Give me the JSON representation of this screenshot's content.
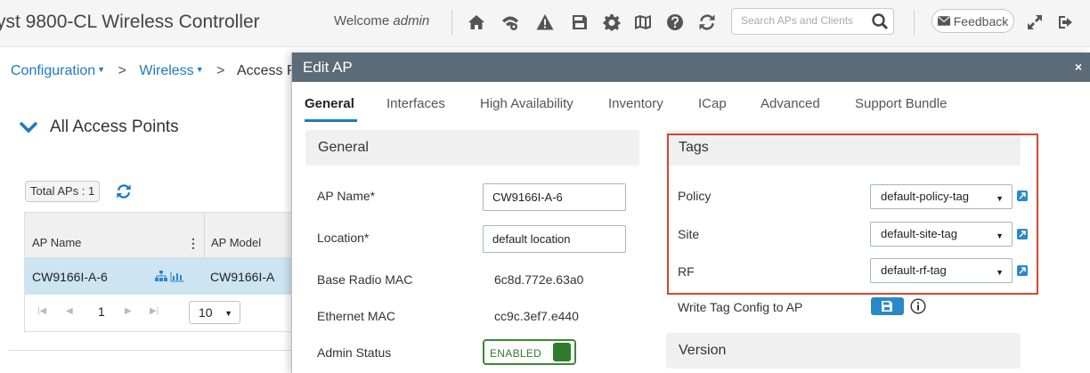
{
  "header": {
    "app_title": "yst 9800-CL Wireless Controller",
    "welcome_prefix": "Welcome",
    "username": "admin",
    "search_placeholder": "Search APs and Clients",
    "feedback_label": "Feedback",
    "icons": [
      "home-icon",
      "wireless-setup-icon",
      "alert-icon",
      "save-icon",
      "gear-icon",
      "map-icon",
      "help-icon",
      "refresh-icon",
      "search-icon",
      "expand-icon",
      "logout-icon"
    ]
  },
  "breadcrumb": {
    "item1": "Configuration",
    "item2": "Wireless",
    "item3": "Access Po",
    "separator": ">"
  },
  "left_panel": {
    "section_title": "All Access Points",
    "total_aps_label": "Total APs : 1",
    "table": {
      "columns": [
        "AP Name",
        "AP Model"
      ],
      "rows": [
        {
          "ap_name": "CW9166I-A-6",
          "ap_model": "CW9166I-A"
        }
      ]
    },
    "pagination": {
      "page": "1",
      "page_size": "10"
    }
  },
  "modal": {
    "title": "Edit AP",
    "close_label": "×",
    "tabs": [
      "General",
      "Interfaces",
      "High Availability",
      "Inventory",
      "ICap",
      "Advanced",
      "Support Bundle"
    ],
    "active_tab": "General",
    "general": {
      "header": "General",
      "ap_name_label": "AP Name*",
      "ap_name_value": "CW9166I-A-6",
      "location_label": "Location*",
      "location_value": "default location",
      "base_radio_mac_label": "Base Radio MAC",
      "base_radio_mac_value": "6c8d.772e.63a0",
      "ethernet_mac_label": "Ethernet MAC",
      "ethernet_mac_value": "cc9c.3ef7.e440",
      "admin_status_label": "Admin Status",
      "admin_status_value": "ENABLED"
    },
    "tags": {
      "header": "Tags",
      "policy_label": "Policy",
      "policy_value": "default-policy-tag",
      "site_label": "Site",
      "site_value": "default-site-tag",
      "rf_label": "RF",
      "rf_value": "default-rf-tag",
      "write_tag_label": "Write Tag Config to AP"
    },
    "version": {
      "header": "Version"
    }
  },
  "colors": {
    "accent": "#1d7abf",
    "modal_header": "#5c6b78",
    "highlight_box": "#d9452f",
    "enabled_green": "#2e7d2b",
    "selected_row": "#cde4f3"
  }
}
